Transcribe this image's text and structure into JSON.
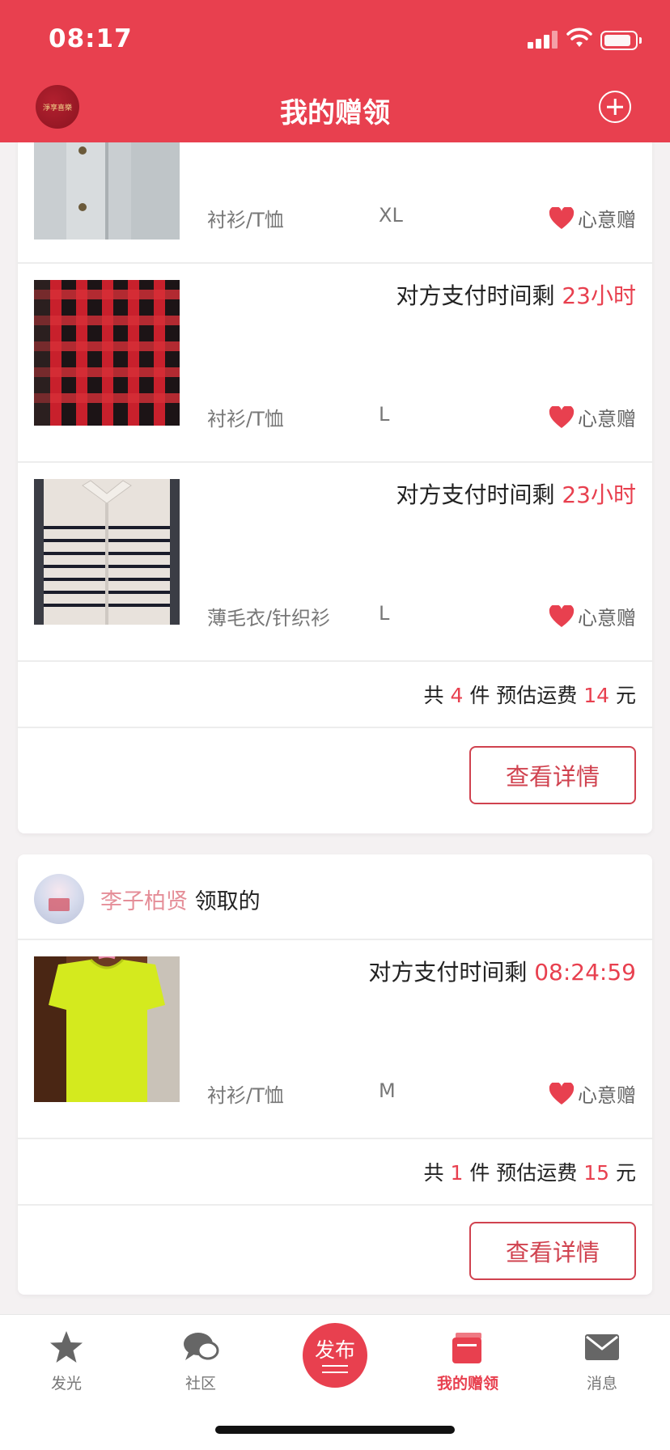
{
  "status_bar": {
    "time": "08:17"
  },
  "nav": {
    "title": "我的赠领",
    "avatar_text": "淨享喜樂"
  },
  "cards": [
    {
      "items": [
        {
          "category": "衬衫/T恤",
          "size": "XL",
          "gift_label": "心意赠",
          "image": "grey-shirt"
        },
        {
          "timer_label": "对方支付时间剩",
          "timer_value": "23小时",
          "category": "衬衫/T恤",
          "size": "L",
          "gift_label": "心意赠",
          "image": "red-plaid-shirt"
        },
        {
          "timer_label": "对方支付时间剩",
          "timer_value": "23小时",
          "category": "薄毛衣/针织衫",
          "size": "L",
          "gift_label": "心意赠",
          "image": "striped-cardigan"
        }
      ],
      "summary": {
        "prefix": "共",
        "count": "4",
        "unit": "件 预估运费",
        "fee": "14",
        "currency": "元"
      },
      "detail_button": "查看详情"
    },
    {
      "owner": {
        "name": "李子柏贤",
        "suffix": "领取的"
      },
      "items": [
        {
          "timer_label": "对方支付时间剩",
          "timer_value": "08:24:59",
          "category": "衬衫/T恤",
          "size": "M",
          "gift_label": "心意赠",
          "image": "yellow-tshirt"
        }
      ],
      "summary": {
        "prefix": "共",
        "count": "1",
        "unit": "件 预估运费",
        "fee": "15",
        "currency": "元"
      },
      "detail_button": "查看详情"
    }
  ],
  "tabbar": {
    "items": [
      {
        "label": "发光",
        "icon": "star-icon"
      },
      {
        "label": "社区",
        "icon": "chat-icon"
      },
      {
        "label": "发布",
        "icon": "publish-icon"
      },
      {
        "label": "我的赠领",
        "icon": "gift-box-icon",
        "active": true
      },
      {
        "label": "消息",
        "icon": "mail-icon"
      }
    ]
  },
  "colors": {
    "accent": "#e8404f",
    "text": "#222222",
    "muted": "#777777"
  }
}
